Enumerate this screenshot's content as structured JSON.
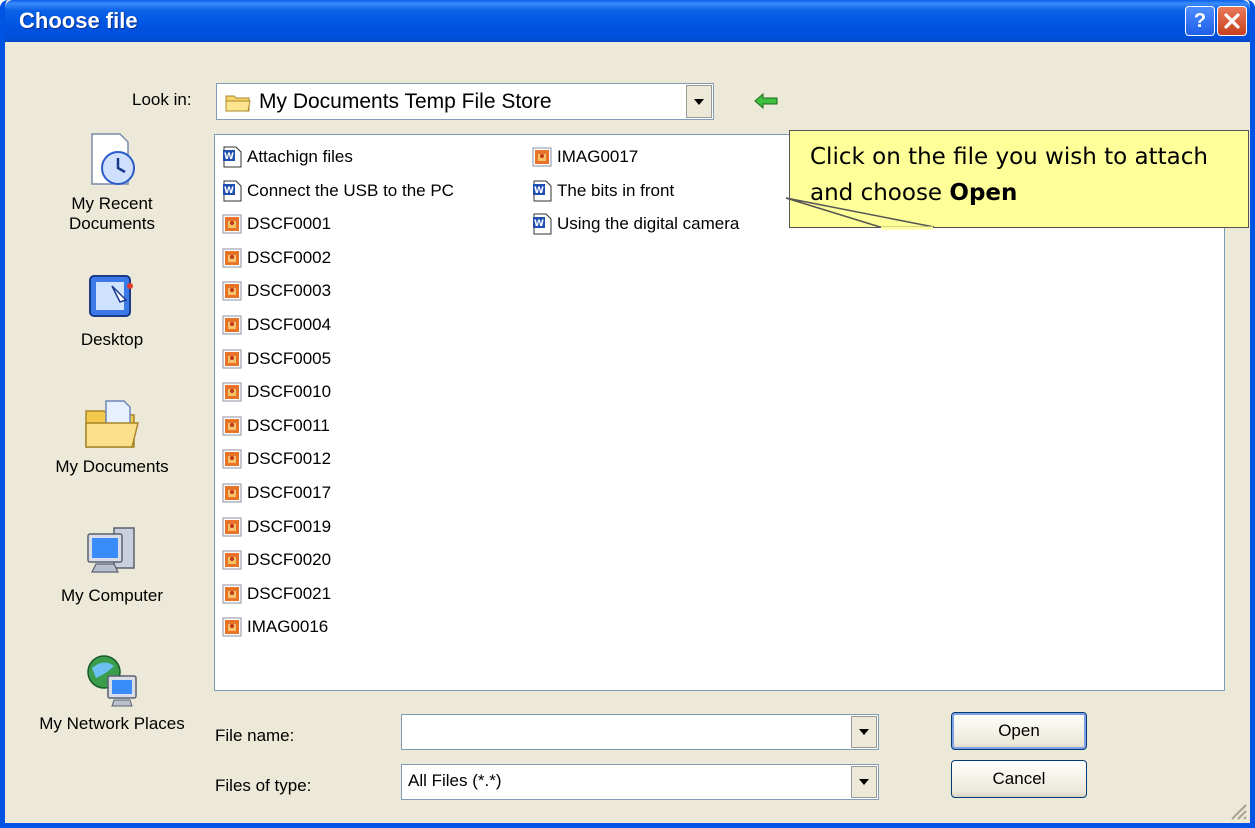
{
  "window": {
    "title": "Choose file"
  },
  "look_in": {
    "label": "Look in:",
    "value": "My Documents Temp File Store"
  },
  "places": [
    {
      "label": "My Recent Documents",
      "icon": "recent-documents-icon"
    },
    {
      "label": "Desktop",
      "icon": "desktop-icon"
    },
    {
      "label": "My Documents",
      "icon": "my-documents-icon"
    },
    {
      "label": "My Computer",
      "icon": "my-computer-icon"
    },
    {
      "label": "My Network Places",
      "icon": "network-places-icon"
    }
  ],
  "files": [
    {
      "name": "Attachign files",
      "type": "word"
    },
    {
      "name": "Connect the USB to the PC",
      "type": "word"
    },
    {
      "name": "DSCF0001",
      "type": "image"
    },
    {
      "name": "DSCF0002",
      "type": "image"
    },
    {
      "name": "DSCF0003",
      "type": "image"
    },
    {
      "name": "DSCF0004",
      "type": "image"
    },
    {
      "name": "DSCF0005",
      "type": "image"
    },
    {
      "name": "DSCF0010",
      "type": "image"
    },
    {
      "name": "DSCF0011",
      "type": "image"
    },
    {
      "name": "DSCF0012",
      "type": "image"
    },
    {
      "name": "DSCF0017",
      "type": "image"
    },
    {
      "name": "DSCF0019",
      "type": "image"
    },
    {
      "name": "DSCF0020",
      "type": "image"
    },
    {
      "name": "DSCF0021",
      "type": "image"
    },
    {
      "name": "IMAG0016",
      "type": "image"
    },
    {
      "name": "IMAG0017",
      "type": "image"
    },
    {
      "name": "The bits in front",
      "type": "word"
    },
    {
      "name": "Using the digital camera",
      "type": "word"
    }
  ],
  "file_name": {
    "label": "File name:",
    "value": ""
  },
  "file_type": {
    "label": "Files of type:",
    "value": "All Files (*.*)"
  },
  "buttons": {
    "open": "Open",
    "cancel": "Cancel"
  },
  "callout": {
    "text": "Click on the file you wish to attach and choose",
    "bold": "Open"
  },
  "colors": {
    "titlebar": "#0054e3",
    "window": "#ece9d8",
    "callout": "#ffff99"
  }
}
